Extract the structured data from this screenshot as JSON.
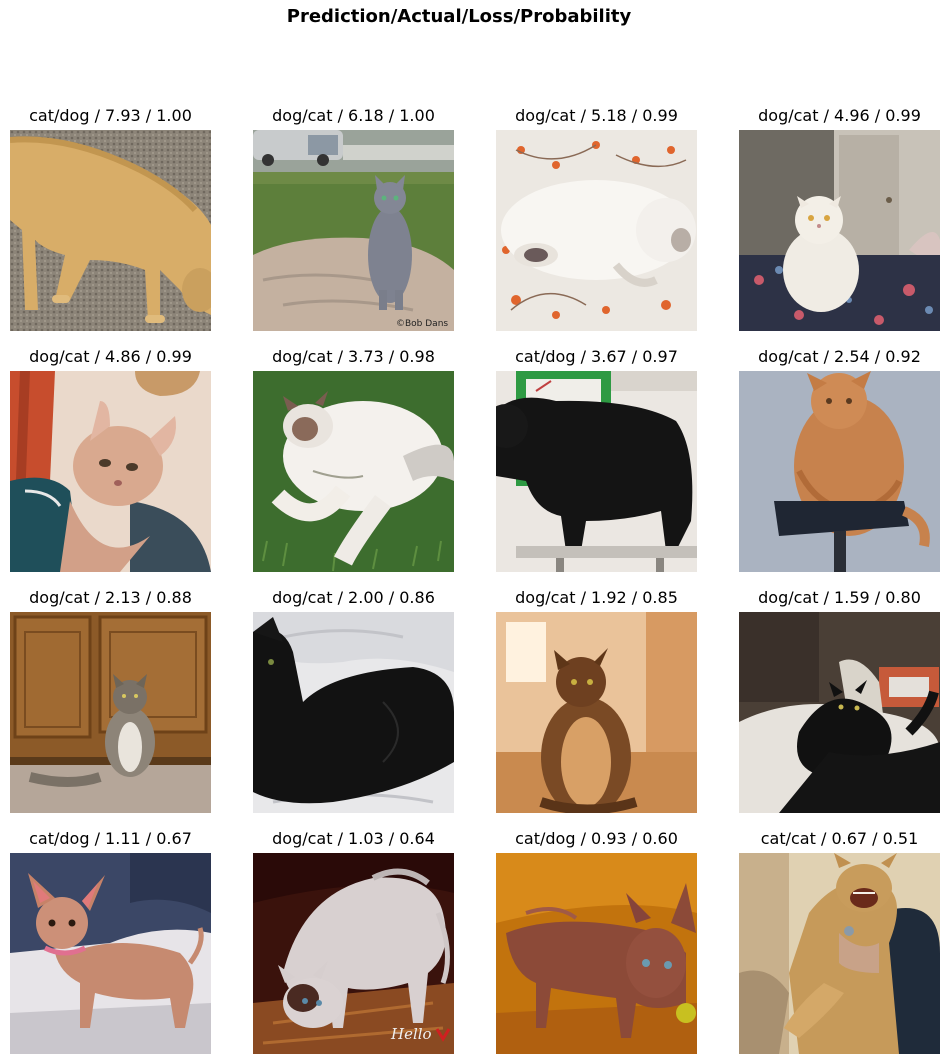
{
  "figure": {
    "title": "Prediction/Actual/Loss/Probability"
  },
  "images": [
    {
      "label": "cat/dog / 7.93 / 1.00",
      "subject": "dog",
      "scene": "tan dog sniffing gray carpet"
    },
    {
      "label": "dog/cat / 6.18 / 1.00",
      "subject": "cat",
      "scene": "gray cat on rock in grass"
    },
    {
      "label": "dog/cat / 5.18 / 0.99",
      "subject": "cat",
      "scene": "white cat on floral bedsheet"
    },
    {
      "label": "dog/cat / 4.96 / 0.99",
      "subject": "cat",
      "scene": "white persian cat on bed"
    },
    {
      "label": "dog/cat / 4.86 / 0.99",
      "subject": "cat",
      "scene": "hairless sphynx cat close up"
    },
    {
      "label": "dog/cat / 3.73 / 0.98",
      "subject": "cat",
      "scene": "white ragdoll cat in grass"
    },
    {
      "label": "cat/dog / 3.67 / 0.97",
      "subject": "dog",
      "scene": "black dog on grooming table"
    },
    {
      "label": "dog/cat / 2.54 / 0.92",
      "subject": "cat",
      "scene": "orange fluffy cat on stool"
    },
    {
      "label": "dog/cat / 2.13 / 0.88",
      "subject": "cat",
      "scene": "tabby cat by wooden cabinets"
    },
    {
      "label": "dog/cat / 2.00 / 0.86",
      "subject": "cat",
      "scene": "black cat on white blanket"
    },
    {
      "label": "dog/cat / 1.92 / 0.85",
      "subject": "cat",
      "scene": "long-haired cat indoors"
    },
    {
      "label": "dog/cat / 1.59 / 0.80",
      "subject": "cat",
      "scene": "black cat on pillow"
    },
    {
      "label": "cat/dog / 1.11 / 0.67",
      "subject": "dog",
      "scene": "chihuahua with pink collar"
    },
    {
      "label": "dog/cat / 1.03 / 0.64",
      "subject": "cat",
      "scene": "sphynx cat crouching"
    },
    {
      "label": "cat/dog / 0.93 / 0.60",
      "subject": "dog",
      "scene": "brown short-haired dog"
    },
    {
      "label": "cat/cat / 0.67 / 0.51",
      "subject": "cat",
      "scene": "yawning cat held by hand"
    }
  ],
  "watermarks": {
    "img1": "©Bob Dans",
    "img13": "Hello"
  }
}
